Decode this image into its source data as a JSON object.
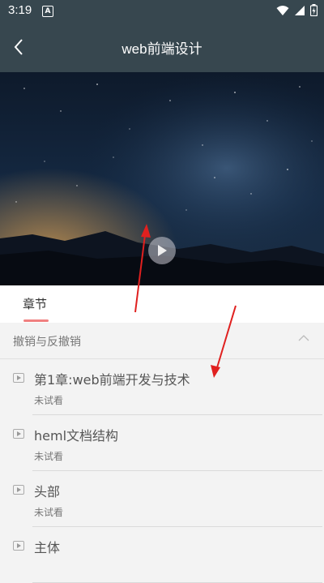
{
  "status_bar": {
    "time": "3:19",
    "notification_letter": "A"
  },
  "header": {
    "title": "web前端设计"
  },
  "tabs": [
    {
      "label": "章节"
    }
  ],
  "section": {
    "title": "撤销与反撤销"
  },
  "chapters": [
    {
      "title": "第1章:web前端开发与技术",
      "status": "未试看"
    },
    {
      "title": "heml文档结构",
      "status": "未试看"
    },
    {
      "title": "头部",
      "status": "未试看"
    },
    {
      "title": "主体",
      "status": ""
    }
  ],
  "colors": {
    "header_bg": "#37474f",
    "tab_indicator": "#f08080",
    "annotation_arrow": "#e0201f"
  },
  "icons": [
    "back-arrow-icon",
    "play-icon",
    "chevron-up-icon",
    "wifi-icon",
    "signal-icon",
    "battery-icon"
  ]
}
